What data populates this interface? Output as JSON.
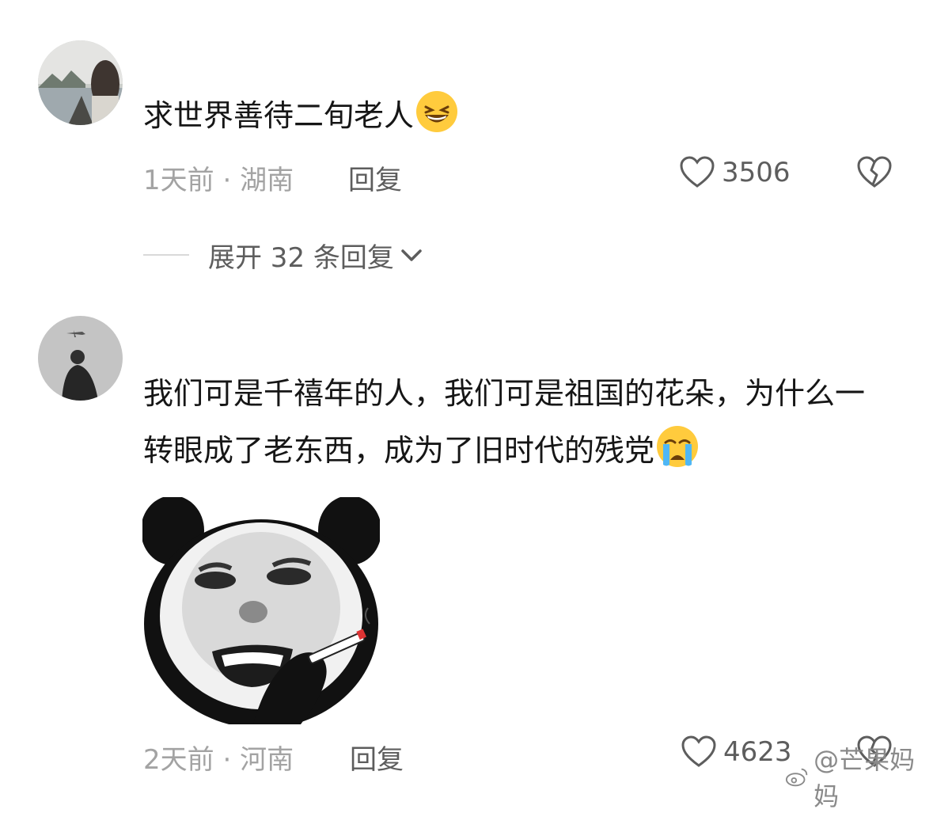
{
  "comments": [
    {
      "text": "求世界善待二旬老人",
      "emoji": "grinning-squint-emoji",
      "time": "1天前",
      "location": "湖南",
      "reply_label": "回复",
      "likes": "3506",
      "expand_label": "展开 32 条回复"
    },
    {
      "text": "我们可是千禧年的人，我们可是祖国的花朵，为什么一转眼成了老东西，成为了旧时代的残党",
      "emoji": "crying-face-emoji",
      "sticker": "panda-crying-smoking-sticker",
      "time": "2天前",
      "location": "河南",
      "reply_label": "回复",
      "likes": "4623"
    }
  ],
  "meta_separator": " · ",
  "watermark": "@芒果妈妈",
  "colors": {
    "text": "#161616",
    "meta": "#a3a3a3",
    "action": "#5d5d5d"
  }
}
